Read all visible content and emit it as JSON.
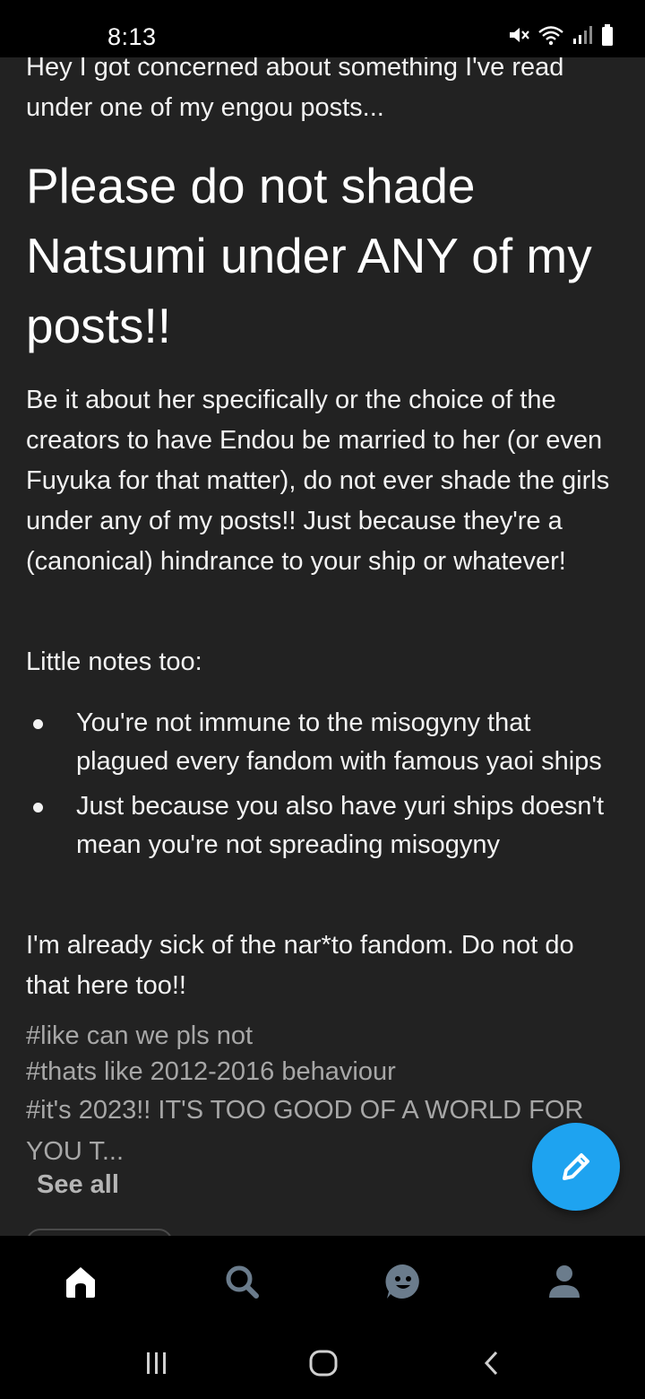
{
  "status_bar": {
    "time": "8:13"
  },
  "post": {
    "intro": "Hey I got concerned about something I've read under one of my engou posts...",
    "headline": "Please do not shade Natsumi under ANY of my posts!!",
    "paragraph_1": "Be it about her specifically or the choice of the creators to have Endou be married to her (or even Fuyuka for that matter), do not ever shade the girls under any of my posts!! Just because they're a (canonical) hindrance to your ship or whatever!",
    "paragraph_2": "Little notes too:",
    "bullets": [
      "You're not immune to the misogyny that plagued every fandom with famous yaoi ships",
      "Just because you also have yuri ships doesn't mean you're not spreading misogyny"
    ],
    "paragraph_3": "I'm already sick of the nar*to fandom. Do not do that here too!!",
    "tags": [
      "#like can we pls not",
      "#thats like 2012-2016 behaviour",
      "#it's 2023!! IT'S TOO GOOD OF A WORLD FOR YOU T..."
    ],
    "see_all_label": "See all"
  },
  "fab": {
    "icon": "pencil-icon",
    "color": "#1ea3f0"
  },
  "bottom_nav": {
    "items": [
      {
        "icon": "home-icon",
        "active": true
      },
      {
        "icon": "search-icon",
        "active": false
      },
      {
        "icon": "activity-face-icon",
        "active": false
      },
      {
        "icon": "account-icon",
        "active": false
      }
    ],
    "active_color": "#ffffff",
    "inactive_color": "#6b7c8c"
  },
  "system_nav": {
    "buttons": [
      "recent-apps-icon",
      "home-circle-icon",
      "back-icon"
    ]
  }
}
